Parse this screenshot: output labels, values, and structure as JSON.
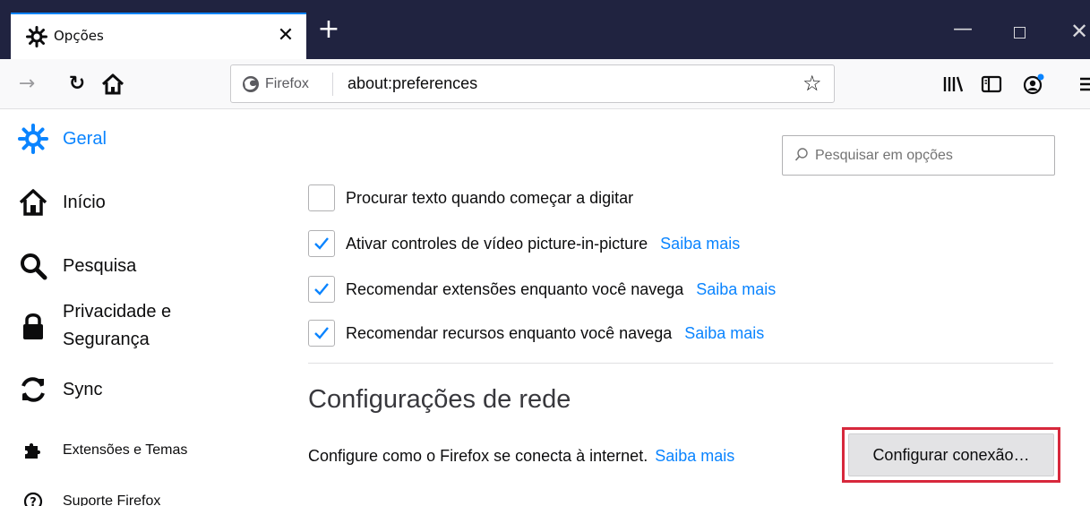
{
  "colors": {
    "accent": "#0a84ff",
    "titlebar": "#202340",
    "highlight": "#d7283c"
  },
  "tab": {
    "title": "Opções",
    "close_glyph": "✕",
    "icon": "gear-icon"
  },
  "window": {
    "new_tab_glyph": "+",
    "minimize_glyph": "—",
    "close_glyph": "✕"
  },
  "navbar": {
    "forward_glyph": "→",
    "reload_glyph": "↻",
    "identity_label": "Firefox",
    "url": "about:preferences",
    "bookmark_glyph": "☆"
  },
  "sidebar": {
    "items": [
      {
        "label": "Geral",
        "icon": "gear-icon",
        "selected": true
      },
      {
        "label": "Início",
        "icon": "home-icon"
      },
      {
        "label": "Pesquisa",
        "icon": "search-icon"
      },
      {
        "label": "Privacidade e",
        "label2": "Segurança",
        "icon": "lock-icon"
      },
      {
        "label": "Sync",
        "icon": "sync-icon"
      },
      {
        "label": "Extensões e Temas",
        "icon": "puzzle-icon"
      },
      {
        "label": "Suporte Firefox",
        "icon": "help-icon"
      }
    ]
  },
  "search": {
    "placeholder": "Pesquisar em opções"
  },
  "options": [
    {
      "label": "Procurar texto quando começar a digitar",
      "checked": false,
      "learn_more": ""
    },
    {
      "label": "Ativar controles de vídeo picture-in-picture",
      "checked": true,
      "learn_more": "Saiba mais"
    },
    {
      "label": "Recomendar extensões enquanto você navega",
      "checked": true,
      "learn_more": "Saiba mais"
    },
    {
      "label": "Recomendar recursos enquanto você navega",
      "checked": true,
      "learn_more": "Saiba mais"
    }
  ],
  "network": {
    "title": "Configurações de rede",
    "description": "Configure como o Firefox se conecta à internet.",
    "learn_more": "Saiba mais",
    "button_label": "Configurar conexão…"
  }
}
